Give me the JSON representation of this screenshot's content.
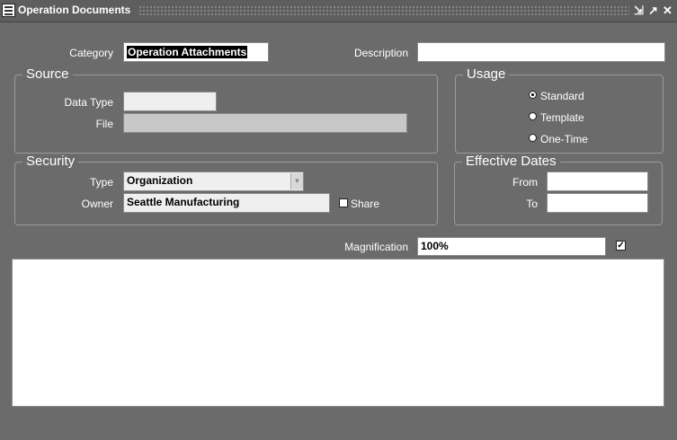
{
  "window": {
    "title": "Operation Documents",
    "minimize_glyph": "⇲",
    "maximize_glyph": "↗",
    "close_glyph": "✕"
  },
  "header": {
    "category_label": "Category",
    "category_value": "Operation Attachments",
    "description_label": "Description",
    "description_value": ""
  },
  "source": {
    "title": "Source",
    "data_type_label": "Data Type",
    "data_type_value": "",
    "file_label": "File",
    "file_value": ""
  },
  "usage": {
    "title": "Usage",
    "options": [
      {
        "label": "Standard",
        "selected": true
      },
      {
        "label": "Template",
        "selected": false
      },
      {
        "label": "One-Time",
        "selected": false
      }
    ]
  },
  "security": {
    "title": "Security",
    "type_label": "Type",
    "type_value": "Organization",
    "owner_label": "Owner",
    "owner_value": "Seattle Manufacturing",
    "share_label": "Share",
    "share_checked": false
  },
  "effective_dates": {
    "title": "Effective Dates",
    "from_label": "From",
    "from_value": "",
    "to_label": "To",
    "to_value": ""
  },
  "magnification": {
    "label": "Magnification",
    "value": "100%",
    "checked": true
  },
  "content": {
    "text": ""
  },
  "colors": {
    "background": "#6b6b6b",
    "field": "#ffffff",
    "disabled_field": "#c8c8c8"
  }
}
